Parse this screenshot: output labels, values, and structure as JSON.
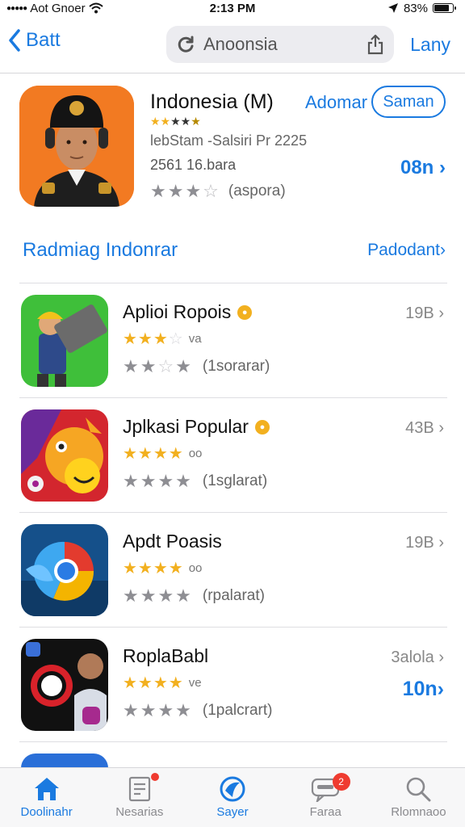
{
  "status": {
    "carrier": "Aot Gnoer",
    "time": "2:13 PM",
    "battery": "83%",
    "battery_level": 0.83
  },
  "nav": {
    "back_label": "Batt",
    "search_text": "Anoonsia",
    "right_label": "Lany"
  },
  "hero": {
    "title": "Indonesia (M)",
    "link": "Adomar",
    "pill": "Saman",
    "subtitle": "lebStam -Salsiri Pr 2225",
    "info": "2561 16.bara",
    "size": "08n",
    "rating_meta": "(aspora)"
  },
  "section": {
    "title": "Radmiag Indonrar",
    "link": "Padodant"
  },
  "apps": [
    {
      "name": "Aplioi Ropois",
      "stars_note": "va",
      "rating_meta": "(1sorarar)",
      "right_top": "19B",
      "right_bottom": ""
    },
    {
      "name": "Jplkasi Popular",
      "stars_note": "oo",
      "rating_meta": "(1sglarat)",
      "right_top": "43B",
      "right_bottom": ""
    },
    {
      "name": "Apdt Poasis",
      "stars_note": "oo",
      "rating_meta": "(rpalarat)",
      "right_top": "19B",
      "right_bottom": ""
    },
    {
      "name": "RoplaBabl",
      "stars_note": "ve",
      "rating_meta": "(1palcrart)",
      "right_top": "3alola",
      "right_bottom": "10n"
    }
  ],
  "tabs": [
    {
      "label": "Doolinahr",
      "icon": "house-icon"
    },
    {
      "label": "Nesarias",
      "icon": "document-icon"
    },
    {
      "label": "Sayer",
      "icon": "compass-icon"
    },
    {
      "label": "Faraa",
      "icon": "chat-icon",
      "badge": "2"
    },
    {
      "label": "Rlomnaoo",
      "icon": "search-icon"
    }
  ]
}
